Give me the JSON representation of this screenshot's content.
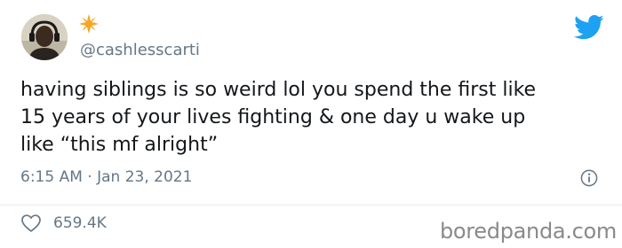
{
  "author": {
    "handle": "@cashlesscarti",
    "avatar_icon": "person-headphones-avatar",
    "badge_icon": "star-icon"
  },
  "tweet": {
    "lines": [
      "having siblings is so weird lol you spend the first like",
      "15 years of your lives fighting & one day u wake up",
      "like “this mf alright”"
    ],
    "timestamp": "6:15 AM · Jan 23, 2021"
  },
  "actions": {
    "like_count": "659.4K",
    "like_icon": "heart-icon",
    "info_icon": "info-icon"
  },
  "branding": {
    "twitter_icon": "twitter-bird-icon",
    "twitter_color": "#1da1f2",
    "watermark": "boredpanda.com"
  }
}
